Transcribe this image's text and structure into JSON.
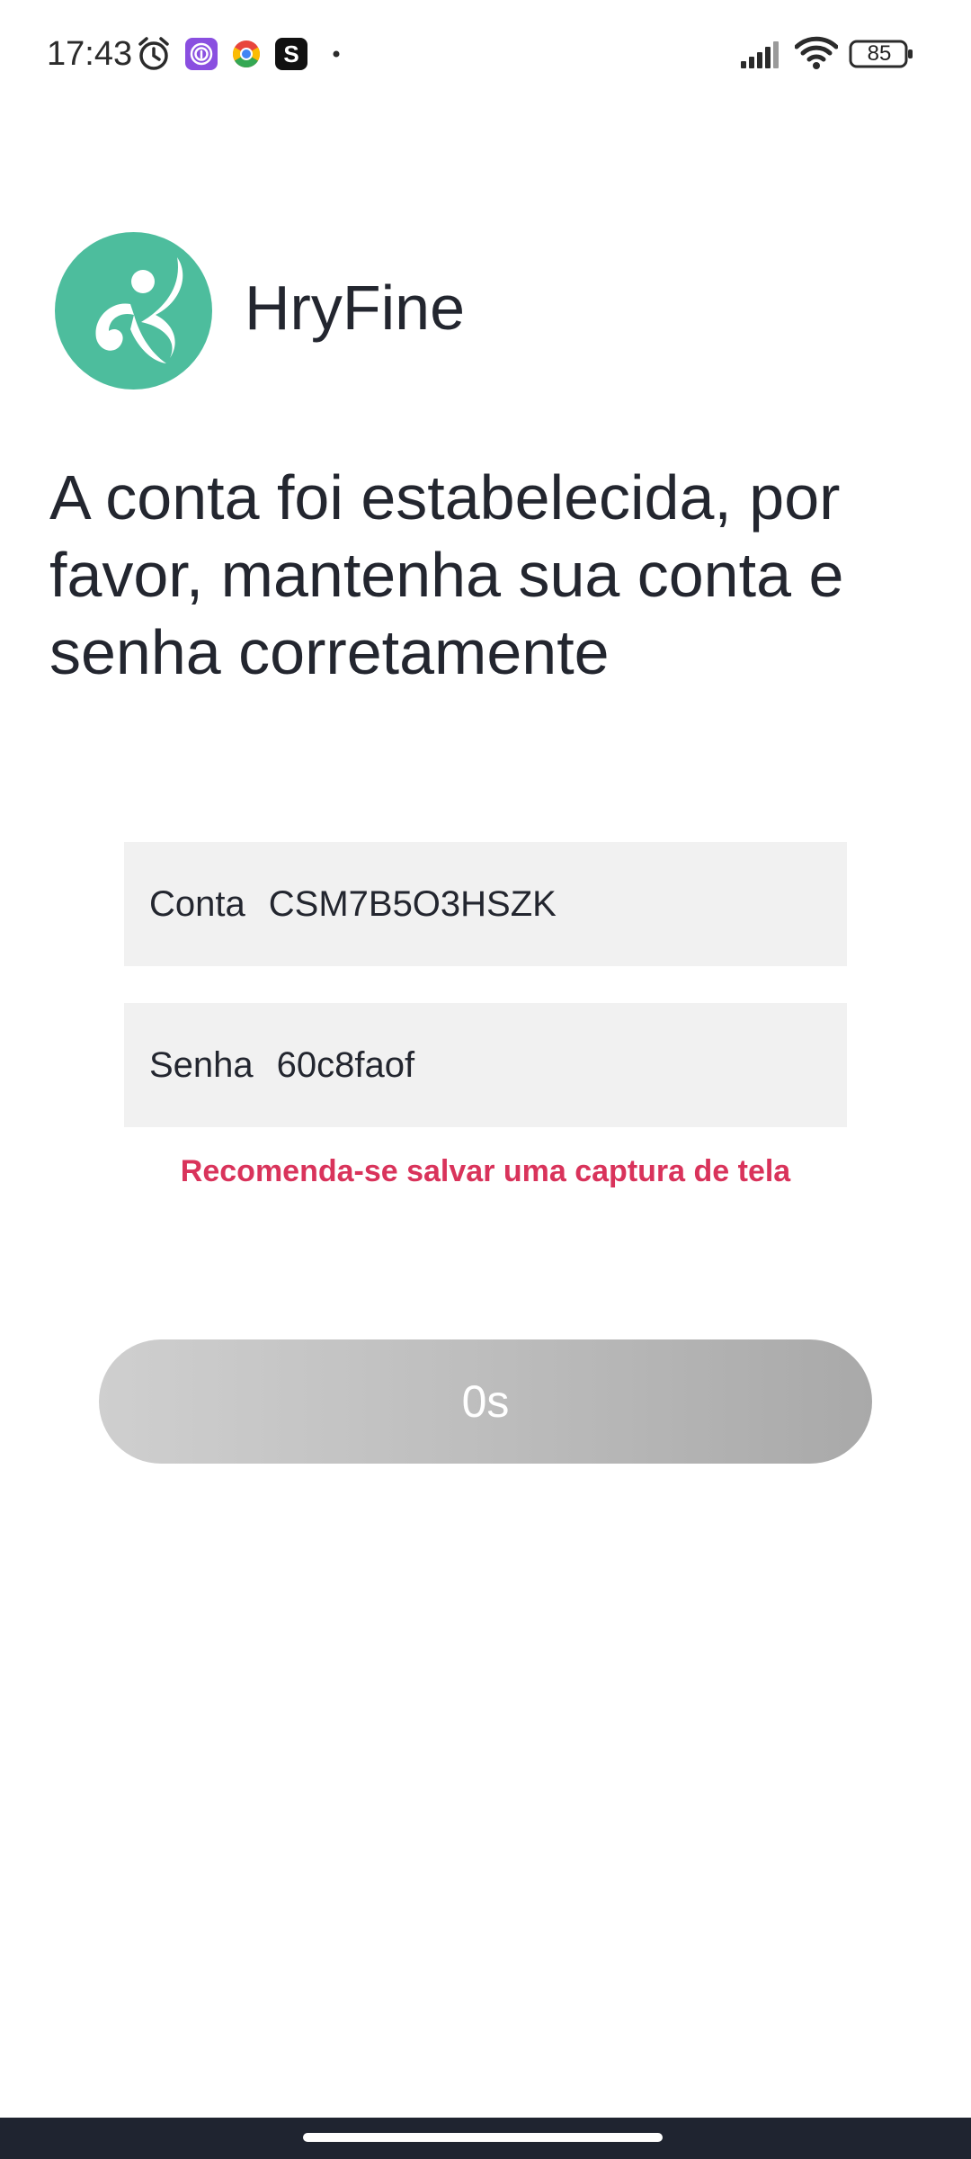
{
  "status_bar": {
    "time": "17:43",
    "battery_level": "85",
    "icons": [
      "alarm-icon",
      "fingerprint-app-icon",
      "chrome-icon",
      "s-app-icon",
      "notification-dot-icon",
      "signal-icon",
      "wifi-icon",
      "battery-icon"
    ]
  },
  "brand": {
    "name": "HryFine",
    "logo_color": "#4dbd9d"
  },
  "headline": "A conta foi estabelecida, por favor, mantenha sua conta e senha corretamente",
  "account": {
    "label": "Conta",
    "value": "CSM7B5O3HSZK"
  },
  "password": {
    "label": "Senha",
    "value": "60c8faof"
  },
  "warning": "Recomenda-se salvar uma captura de tela",
  "warning_color": "#d9335b",
  "countdown_button": {
    "label": "0s"
  }
}
